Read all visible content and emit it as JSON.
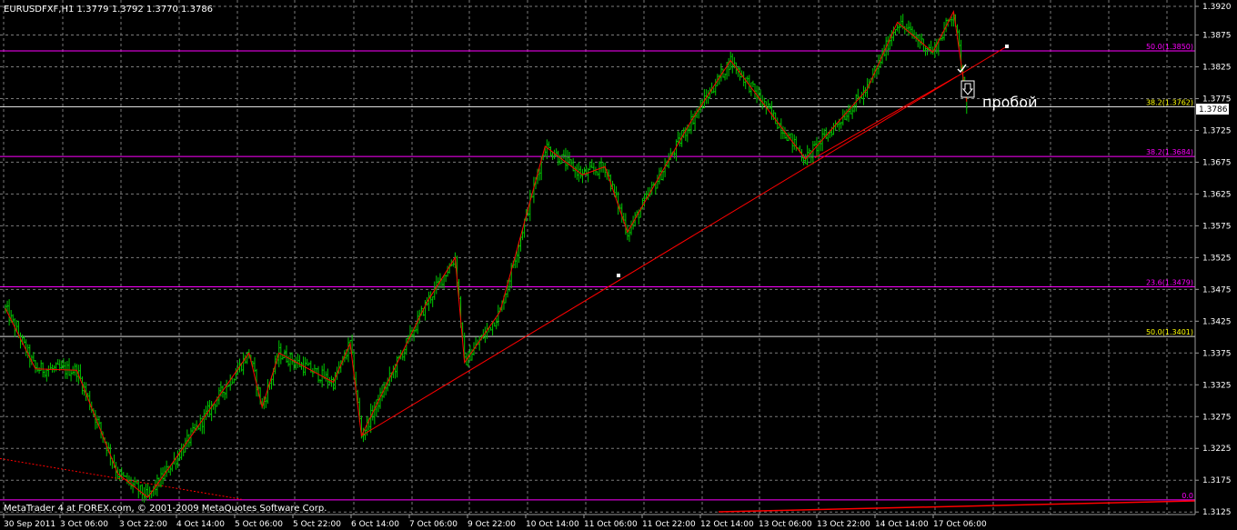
{
  "window": {
    "symbol_header": "EURUSDFXF,H1  1.3779 1.3792 1.3770 1.3786",
    "footer": "MetaTrader 4 at FOREX.com, © 2001-2009 MetaQuotes Software Corp."
  },
  "colors": {
    "background": "#000000",
    "grid": "#7a7a7a",
    "candles": "#00c800",
    "trendline": "#ff0000",
    "fib_line": "#ff00ff",
    "fib_label_yellow": "#ffff00",
    "fib_label_magenta": "#ff00ff",
    "text": "#ffffff"
  },
  "annotations": {
    "breakout_label": "пробой",
    "breakout_icon": "down-arrow-box-icon",
    "check_icon": "checkmark-icon"
  },
  "chart_data": {
    "type": "candlestick",
    "symbol": "EURUSDFXF",
    "timeframe": "H1",
    "ohlc_header": {
      "open": 1.3779,
      "high": 1.3792,
      "low": 1.377,
      "close": 1.3786
    },
    "current_price": "1.3786",
    "ylim": [
      1.3121,
      1.393
    ],
    "y_ticks": [
      "1.3920",
      "1.3875",
      "1.3825",
      "1.3775",
      "1.3725",
      "1.3675",
      "1.3625",
      "1.3575",
      "1.3525",
      "1.3475",
      "1.3425",
      "1.3375",
      "1.3325",
      "1.3275",
      "1.3225",
      "1.3175",
      "1.3125"
    ],
    "x_ticks": [
      "30 Sep 2011",
      "3 Oct 06:00",
      "3 Oct 22:00",
      "4 Oct 14:00",
      "5 Oct 06:00",
      "5 Oct 22:00",
      "6 Oct 14:00",
      "7 Oct 06:00",
      "9 Oct 22:00",
      "10 Oct 14:00",
      "11 Oct 06:00",
      "11 Oct 22:00",
      "12 Oct 14:00",
      "13 Oct 06:00",
      "13 Oct 22:00",
      "14 Oct 14:00",
      "17 Oct 06:00"
    ],
    "fib_levels": [
      {
        "label": "50.0(1.3850)",
        "value": 1.385,
        "line": "magenta",
        "text_color": "magenta"
      },
      {
        "label": "38.2(1.3762)",
        "value": 1.3762,
        "line": "white",
        "text_color": "yellow"
      },
      {
        "label": "38.2(1.3684)",
        "value": 1.3684,
        "line": "magenta",
        "text_color": "magenta"
      },
      {
        "label": "23.6(1.3479)",
        "value": 1.3479,
        "line": "magenta",
        "text_color": "magenta"
      },
      {
        "label": "50.0(1.3401)",
        "value": 1.3401,
        "line": "white",
        "text_color": "yellow"
      },
      {
        "label": "0.0",
        "value": 1.3144,
        "line": "magenta",
        "text_color": "magenta"
      }
    ],
    "zigzag": [
      [
        0,
        1.3445
      ],
      [
        16,
        1.335
      ],
      [
        38,
        1.3348
      ],
      [
        60,
        1.3185
      ],
      [
        76,
        1.3148
      ],
      [
        91,
        1.321
      ],
      [
        130,
        1.3375
      ],
      [
        137,
        1.329
      ],
      [
        146,
        1.3375
      ],
      [
        175,
        1.3329
      ],
      [
        184,
        1.339
      ],
      [
        190,
        1.3245
      ],
      [
        225,
        1.3455
      ],
      [
        240,
        1.3525
      ],
      [
        245,
        1.336
      ],
      [
        264,
        1.344
      ],
      [
        288,
        1.37
      ],
      [
        308,
        1.3655
      ],
      [
        320,
        1.3668
      ],
      [
        332,
        1.3565
      ],
      [
        366,
        1.374
      ],
      [
        387,
        1.3835
      ],
      [
        427,
        1.368
      ],
      [
        460,
        1.379
      ],
      [
        476,
        1.3895
      ],
      [
        495,
        1.3848
      ],
      [
        506,
        1.3912
      ],
      [
        513,
        1.377
      ]
    ],
    "trendline_main": [
      [
        190,
        1.3245
      ],
      [
        547,
        1.3887
      ]
    ],
    "trendline_lower": [
      [
        0,
        1.3209
      ],
      [
        126,
        1.3145
      ]
    ],
    "trendline_upper": [
      [
        432,
        1.3682
      ],
      [
        513,
        1.3824
      ]
    ],
    "bars_count": 520
  }
}
